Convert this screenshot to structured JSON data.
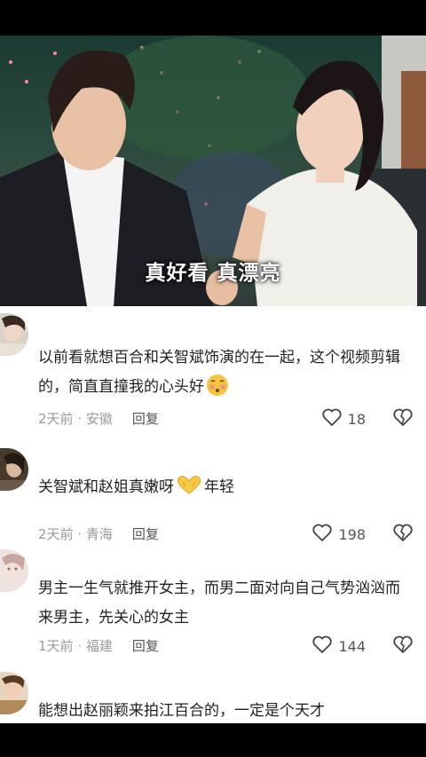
{
  "video": {
    "subtitle": "真好看 真漂亮"
  },
  "comments": [
    {
      "text": "以前看就想百合和关智斌饰演的在一起，这个视频剪辑的，简直直撞我的心头好",
      "emoji": "blushing-face",
      "time": "2天前",
      "location": "安徽",
      "reply_label": "回复",
      "likes": "18"
    },
    {
      "text": "关智斌和赵姐真嫩呀",
      "emoji": "heart-hands",
      "text_after": "年轻",
      "time": "2天前",
      "location": "青海",
      "reply_label": "回复",
      "likes": "198"
    },
    {
      "text": "男主一生气就推开女主，而男二面对向自己气势汹汹而来男主，先关心的女主",
      "time": "1天前",
      "location": "福建",
      "reply_label": "回复",
      "likes": "144"
    },
    {
      "text": "能想出赵丽颖来拍江百合的，一定是个天才"
    }
  ],
  "colors": {
    "text": "#222222",
    "meta": "#9a9a9a",
    "background": "#ffffff"
  }
}
